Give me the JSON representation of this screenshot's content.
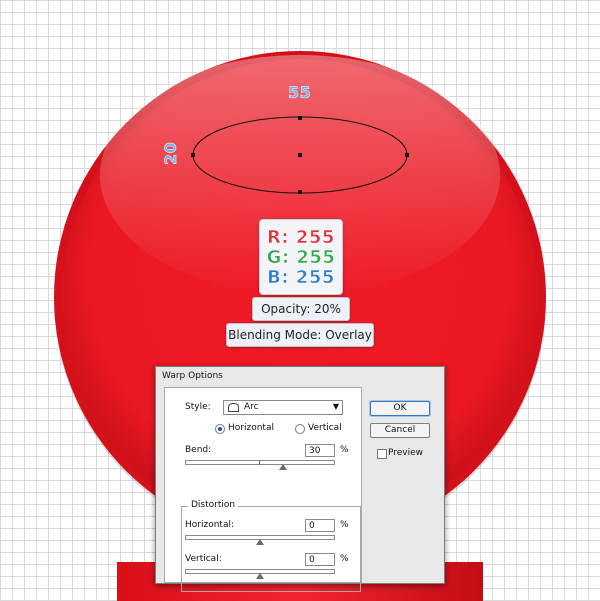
{
  "dimensions": {
    "width_label": "55",
    "height_label": "20"
  },
  "color_callout": {
    "r": "R: 255",
    "g": "G: 255",
    "b": "B: 255"
  },
  "opacity_label": "Opacity: 20%",
  "blend_label": "Blending Mode: Overlay",
  "colors": {
    "red": "#ee1c25",
    "grid": "#d9d9d9"
  },
  "dialog": {
    "title": "Warp Options",
    "style_label": "Style:",
    "style_value": "Arc",
    "orientation": {
      "horizontal": "Horizontal",
      "vertical": "Vertical",
      "selected": "Horizontal"
    },
    "bend_label": "Bend:",
    "bend_value": "30",
    "bend_unit": "%",
    "bend_level": 0.65,
    "distortion_title": "Distortion",
    "horizontal_label": "Horizontal:",
    "horizontal_value": "0",
    "horizontal_unit": "%",
    "horizontal_level": 0.5,
    "vertical_label": "Vertical:",
    "vertical_value": "0",
    "vertical_unit": "%",
    "vertical_level": 0.5,
    "ok_label": "OK",
    "cancel_label": "Cancel",
    "preview_label": "Preview",
    "preview_checked": false
  }
}
